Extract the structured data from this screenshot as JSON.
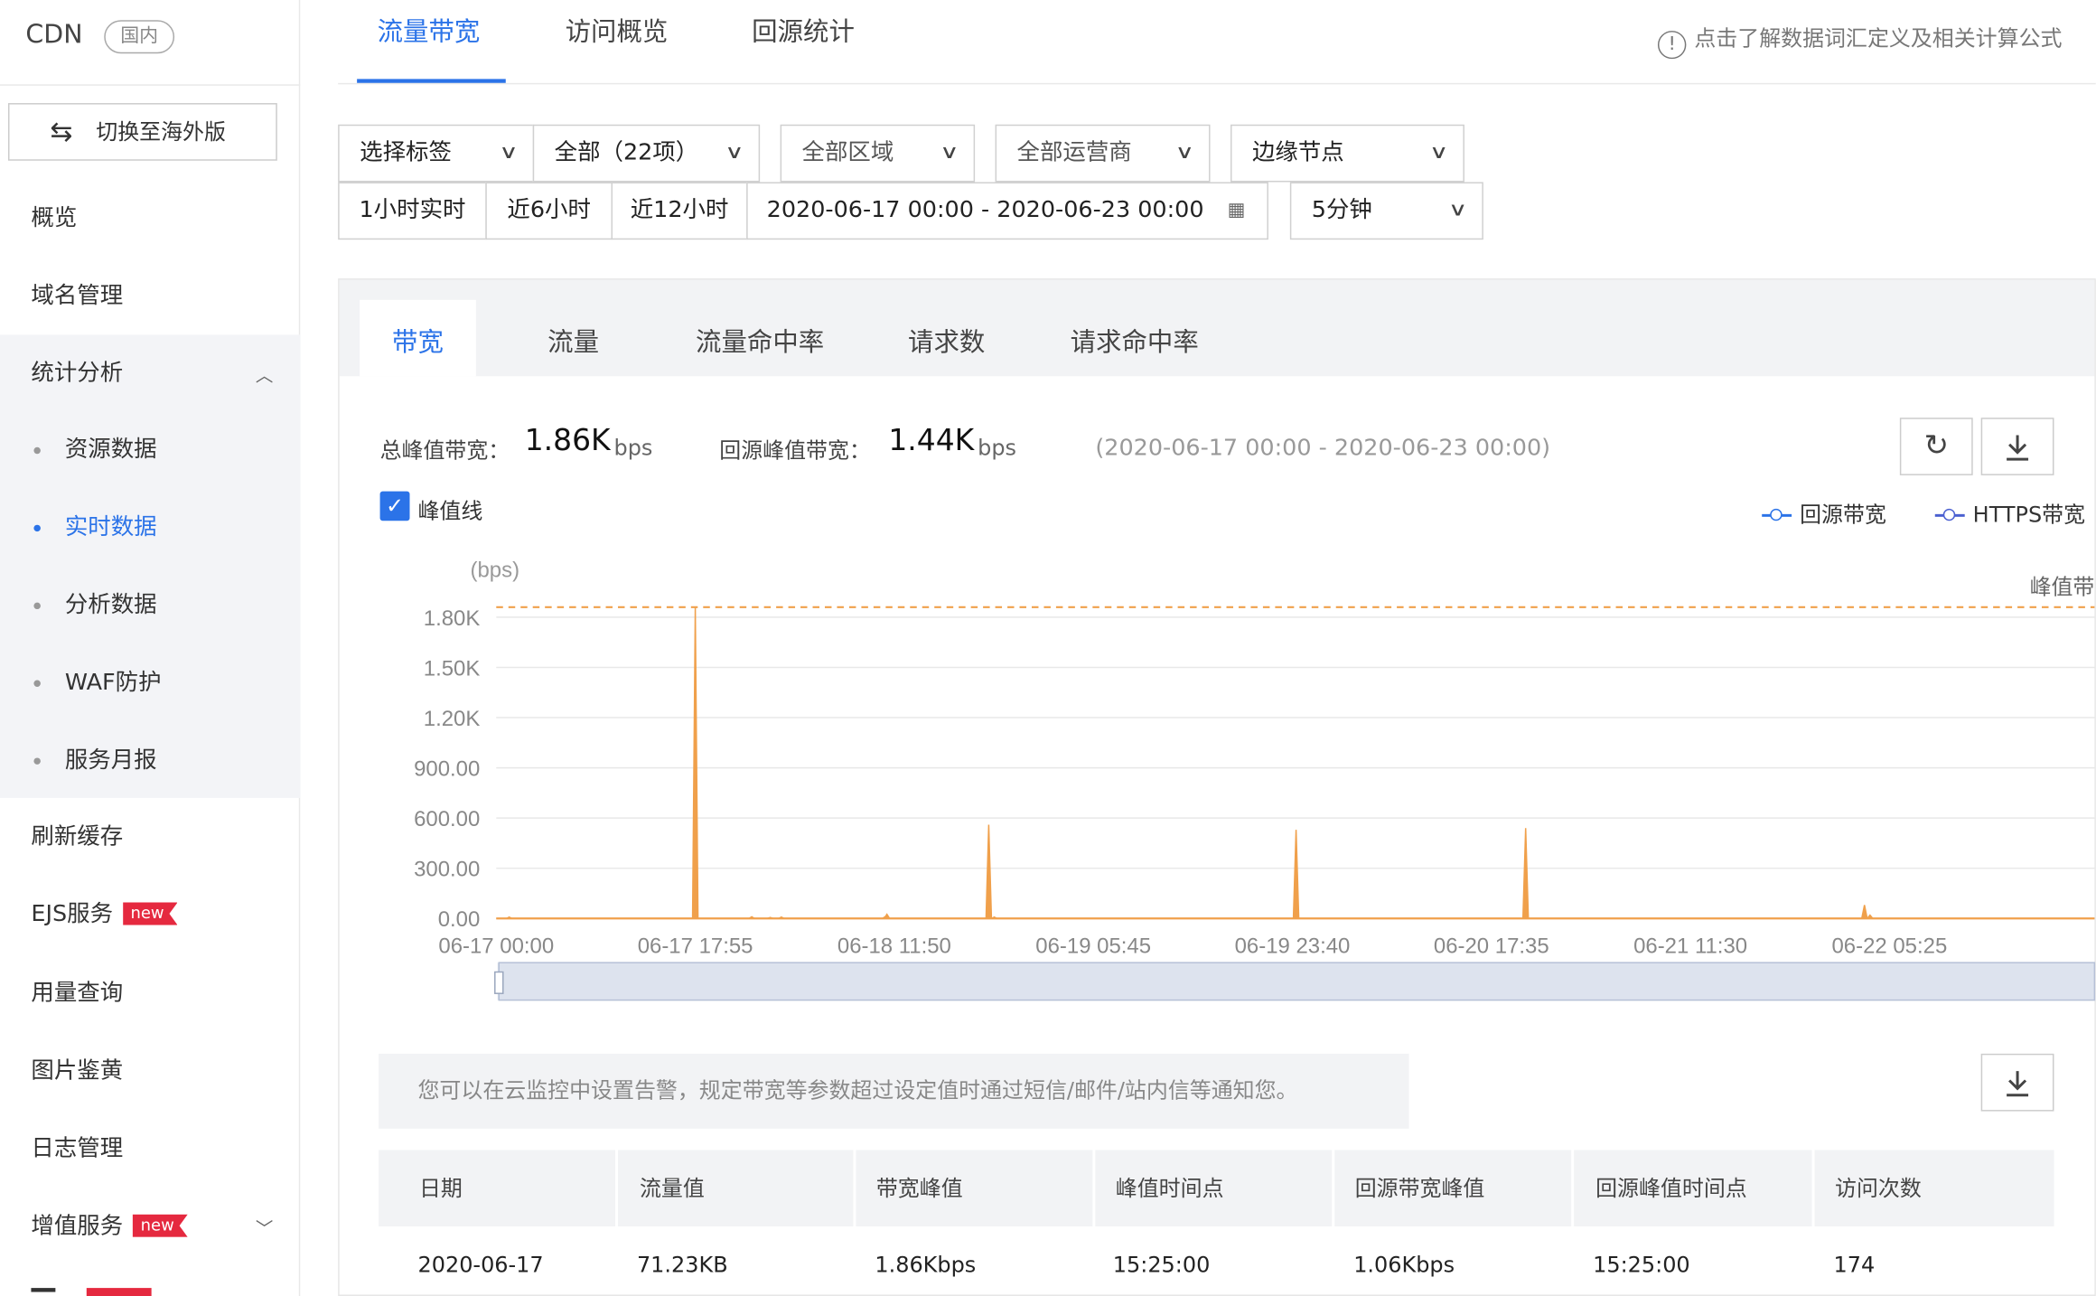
{
  "sidebar": {
    "title": "CDN",
    "region_badge": "国内",
    "switch_label": "切换至海外版",
    "items": {
      "overview": "概览",
      "domain": "域名管理",
      "stats": "统计分析",
      "resource": "资源数据",
      "realtime": "实时数据",
      "analysis": "分析数据",
      "waf": "WAF防护",
      "monthly": "服务月报",
      "refresh": "刷新缓存",
      "ejs": "EJS服务",
      "usage": "用量查询",
      "image": "图片鉴黄",
      "log": "日志管理",
      "value_added": "增值服务"
    },
    "new_tag": "new"
  },
  "top_tabs": [
    "流量带宽",
    "访问概览",
    "回源统计"
  ],
  "help_text": "点击了解数据词汇定义及相关计算公式",
  "filters": {
    "tag": "选择标签",
    "domains": "全部（22项）",
    "region": "全部区域",
    "isp": "全部运营商",
    "node": "边缘节点",
    "quick1": "1小时实时",
    "quick2": "近6小时",
    "quick3": "近12小时",
    "date_range": "2020-06-17 00:00 - 2020-06-23 00:00",
    "granularity": "5分钟"
  },
  "sub_tabs": [
    "带宽",
    "流量",
    "流量命中率",
    "请求数",
    "请求命中率"
  ],
  "stats": {
    "total_peak_label": "总峰值带宽：",
    "total_peak_value": "1.86K",
    "total_peak_unit": "bps",
    "origin_peak_label": "回源峰值带宽：",
    "origin_peak_value": "1.44K",
    "origin_peak_unit": "bps",
    "range": "(2020-06-17 00:00 - 2020-06-23 00:00)"
  },
  "peak_checkbox_label": "峰值线",
  "legend": [
    "回源带宽",
    "HTTPS带宽"
  ],
  "chart_data": {
    "type": "line",
    "ylabel": "(bps)",
    "yticks": [
      "0.00",
      "300.00",
      "600.00",
      "900.00",
      "1.20K",
      "1.50K",
      "1.80K"
    ],
    "ylim": [
      0,
      1800
    ],
    "xticks": [
      "06-17 00:00",
      "06-17 17:55",
      "06-18 11:50",
      "06-19 05:45",
      "06-19 23:40",
      "06-20 17:35",
      "06-21 11:30",
      "06-22 05:25"
    ],
    "peak_line": {
      "label": "峰值带",
      "value": 1860
    },
    "series_color": "#f0a04b",
    "spikes": [
      {
        "t": "06-17 01:10",
        "v": 8
      },
      {
        "t": "06-17 17:55",
        "v": 1860
      },
      {
        "t": "06-17 23:00",
        "v": 10
      },
      {
        "t": "06-18 00:40",
        "v": 6
      },
      {
        "t": "06-18 01:40",
        "v": 8
      },
      {
        "t": "06-18 11:00",
        "v": 10
      },
      {
        "t": "06-18 11:10",
        "v": 25
      },
      {
        "t": "06-18 20:20",
        "v": 560
      },
      {
        "t": "06-18 20:50",
        "v": 8
      },
      {
        "t": "06-20 00:00",
        "v": 530
      },
      {
        "t": "06-20 20:40",
        "v": 540
      },
      {
        "t": "06-22 03:10",
        "v": 80
      },
      {
        "t": "06-22 03:40",
        "v": 20
      }
    ]
  },
  "notice": "您可以在云监控中设置告警，规定带宽等参数超过设定值时通过短信/邮件/站内信等通知您。",
  "table": {
    "headers": [
      "日期",
      "流量值",
      "带宽峰值",
      "峰值时间点",
      "回源带宽峰值",
      "回源峰值时间点",
      "访问次数"
    ],
    "rows": [
      [
        "2020-06-17",
        "71.23KB",
        "1.86Kbps",
        "15:25:00",
        "1.06Kbps",
        "15:25:00",
        "174"
      ]
    ]
  },
  "colors": {
    "accent": "#2b73e8",
    "series": "#f0a04b",
    "new_tag": "#e5293f"
  }
}
